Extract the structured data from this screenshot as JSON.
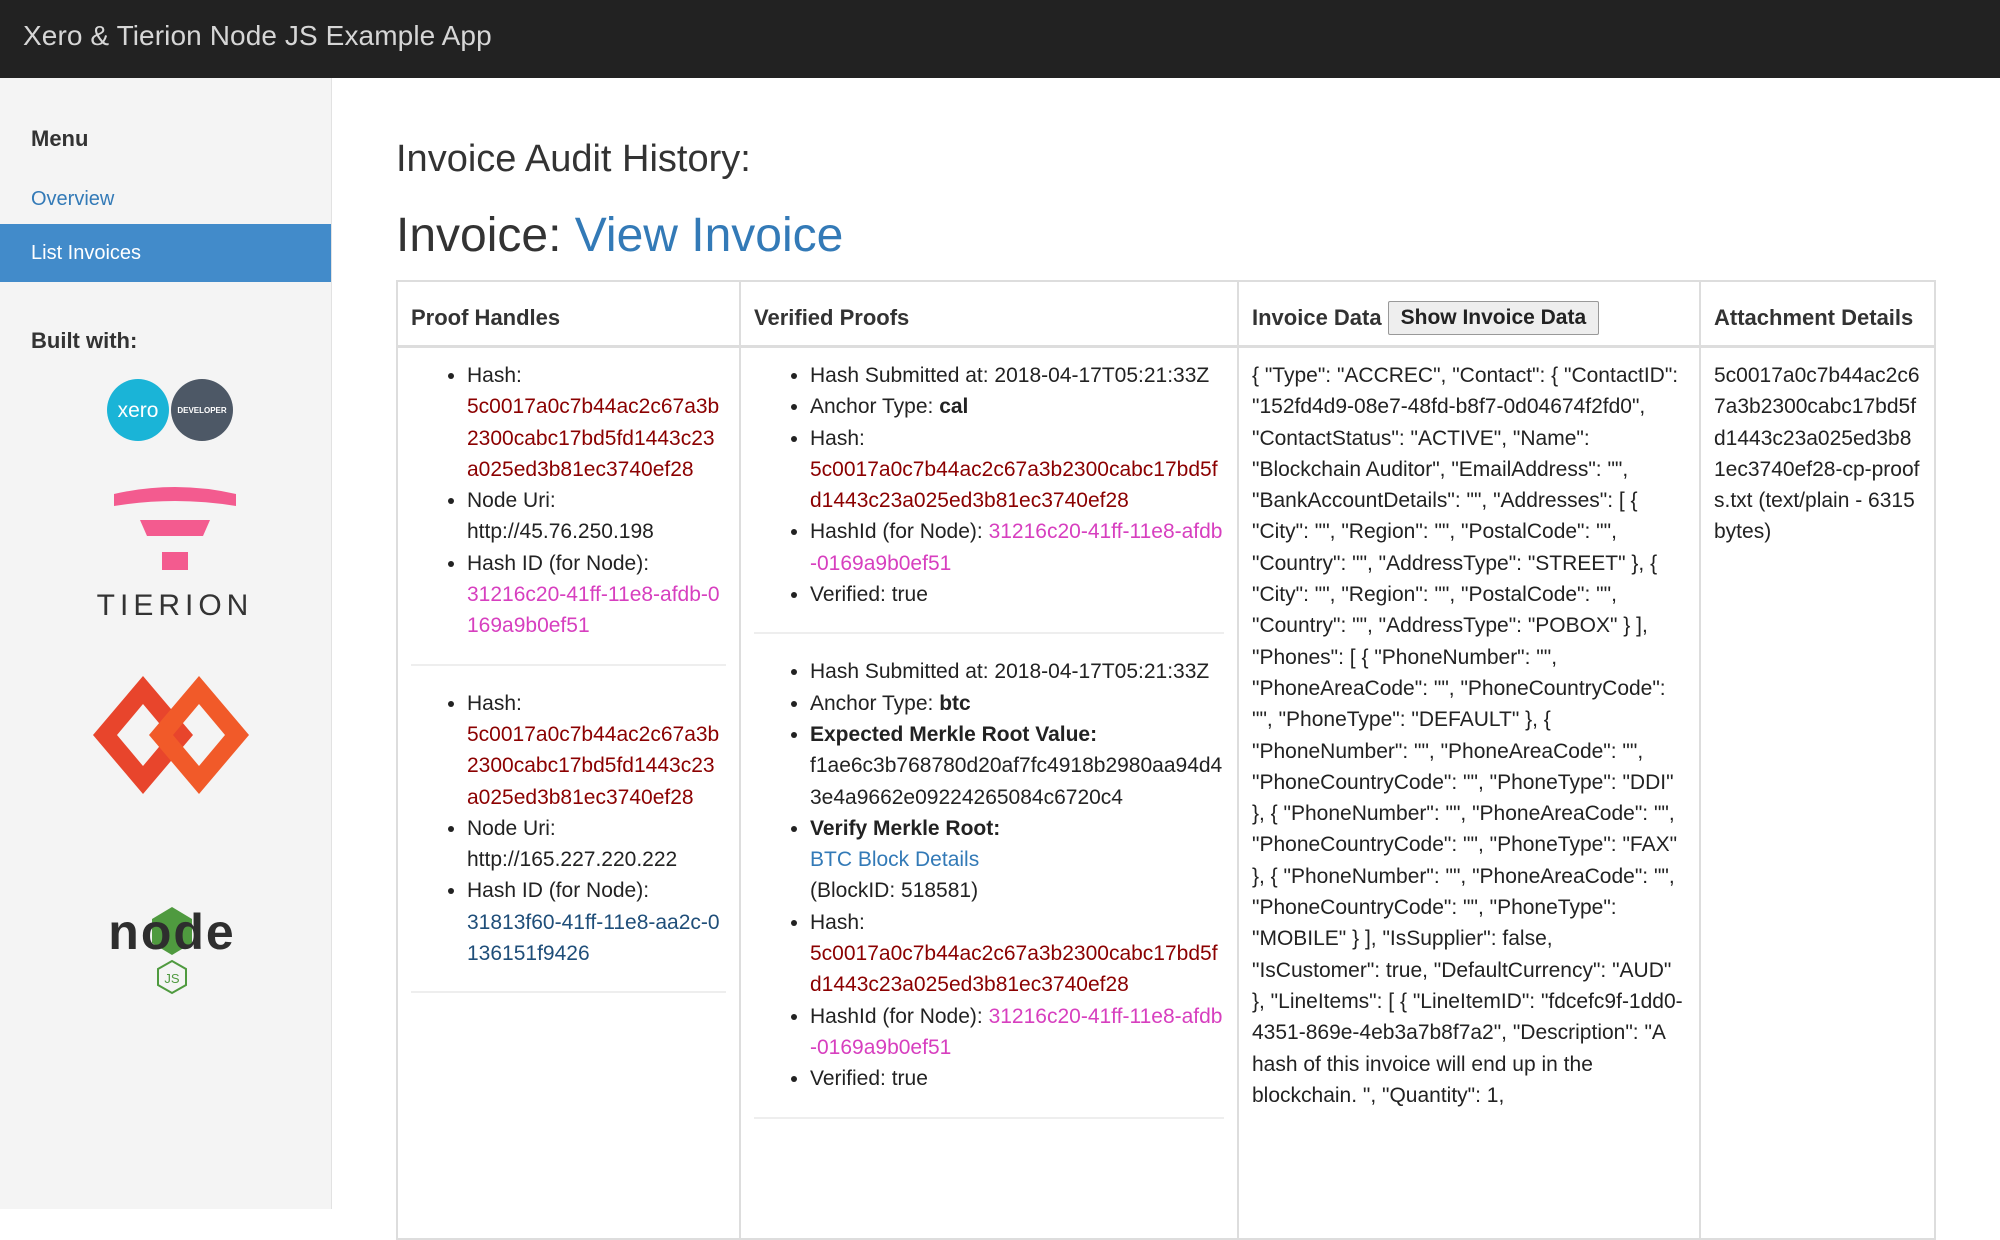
{
  "app": {
    "title": "Xero & Tierion Node JS Example App"
  },
  "sidebar": {
    "menu_heading": "Menu",
    "items": [
      {
        "label": "Overview"
      },
      {
        "label": "List Invoices"
      }
    ],
    "built_with_heading": "Built with:",
    "logos": {
      "xero_text": "xero",
      "developer_text": "DEVELOPER",
      "tierion_text": "TIERION",
      "node_text": "node",
      "js_text": "JS"
    }
  },
  "main": {
    "page_heading": "Invoice Audit History:",
    "invoice_prefix": "Invoice:",
    "invoice_link": "View Invoice",
    "table": {
      "headers": {
        "proof_handles": "Proof Handles",
        "verified_proofs": "Verified Proofs",
        "invoice_data": "Invoice Data",
        "show_invoice_button": "Show Invoice Data",
        "attachment_details": "Attachment Details"
      },
      "proof_handles": [
        {
          "hash_label": "Hash:",
          "hash": "5c0017a0c7b44ac2c67a3b2300cabc17bd5fd1443c23a025ed3b81ec3740ef28",
          "node_uri_label": "Node Uri:",
          "node_uri": "http://45.76.250.198",
          "hash_id_label": "Hash ID (for Node):",
          "hash_id": "31216c20-41ff-11e8-afdb-0169a9b0ef51"
        },
        {
          "hash_label": "Hash:",
          "hash": "5c0017a0c7b44ac2c67a3b2300cabc17bd5fd1443c23a025ed3b81ec3740ef28",
          "node_uri_label": "Node Uri:",
          "node_uri": "http://165.227.220.222",
          "hash_id_label": "Hash ID (for Node):",
          "hash_id": "31813f60-41ff-11e8-aa2c-0136151f9426"
        }
      ],
      "verified_proofs": [
        {
          "submitted": "Hash Submitted at: 2018-04-17T05:21:33Z",
          "anchor_label": "Anchor Type: ",
          "anchor_value": "cal",
          "hash_label": "Hash:",
          "hash": "5c0017a0c7b44ac2c67a3b2300cabc17bd5fd1443c23a025ed3b81ec3740ef28",
          "hashid_label": "HashId (for Node): ",
          "hashid": "31216c20-41ff-11e8-afdb-0169a9b0ef51",
          "verified": "Verified: true"
        },
        {
          "submitted": "Hash Submitted at: 2018-04-17T05:21:33Z",
          "anchor_label": "Anchor Type: ",
          "anchor_value": "btc",
          "merkle_label": "Expected Merkle Root Value:",
          "merkle_value": "f1ae6c3b768780d20af7fc4918b2980aa94d43e4a9662e09224265084c6720c4",
          "verify_label": "Verify Merkle Root:",
          "btc_link": "BTC Block Details",
          "block_id": "(BlockID: 518581)",
          "hash_label": "Hash:",
          "hash": "5c0017a0c7b44ac2c67a3b2300cabc17bd5fd1443c23a025ed3b81ec3740ef28",
          "hashid_label": "HashId (for Node): ",
          "hashid": "31216c20-41ff-11e8-afdb-0169a9b0ef51",
          "verified": "Verified: true"
        }
      ],
      "invoice_data": "{ \"Type\": \"ACCREC\", \"Contact\": { \"ContactID\": \"152fd4d9-08e7-48fd-b8f7-0d04674f2fd0\", \"ContactStatus\": \"ACTIVE\", \"Name\": \"Blockchain Auditor\", \"EmailAddress\": \"\", \"BankAccountDetails\": \"\", \"Addresses\": [ { \"City\": \"\", \"Region\": \"\", \"PostalCode\": \"\", \"Country\": \"\", \"AddressType\": \"STREET\" }, { \"City\": \"\", \"Region\": \"\", \"PostalCode\": \"\", \"Country\": \"\", \"AddressType\": \"POBOX\" } ], \"Phones\": [ { \"PhoneNumber\": \"\", \"PhoneAreaCode\": \"\", \"PhoneCountryCode\": \"\", \"PhoneType\": \"DEFAULT\" }, { \"PhoneNumber\": \"\", \"PhoneAreaCode\": \"\", \"PhoneCountryCode\": \"\", \"PhoneType\": \"DDI\" }, { \"PhoneNumber\": \"\", \"PhoneAreaCode\": \"\", \"PhoneCountryCode\": \"\", \"PhoneType\": \"FAX\" }, { \"PhoneNumber\": \"\", \"PhoneAreaCode\": \"\", \"PhoneCountryCode\": \"\", \"PhoneType\": \"MOBILE\" } ], \"IsSupplier\": false, \"IsCustomer\": true, \"DefaultCurrency\": \"AUD\" }, \"LineItems\": [ { \"LineItemID\": \"fdcefc9f-1dd0-4351-869e-4eb3a7b8f7a2\", \"Description\": \"A hash of this invoice will end up in the blockchain. \", \"Quantity\": 1,",
      "attachment": "5c0017a0c7b44ac2c67a3b2300cabc17bd5fd1443c23a025ed3b81ec3740ef28-cp-proofs.txt (text/plain - 6315 bytes)"
    }
  },
  "colors": {
    "topbar": "#222222",
    "sidebar_bg": "#f4f4f4",
    "active_nav": "#428bca",
    "link": "#337ab7",
    "hash": "#8b0000",
    "hash_id": "#d73fbf"
  }
}
